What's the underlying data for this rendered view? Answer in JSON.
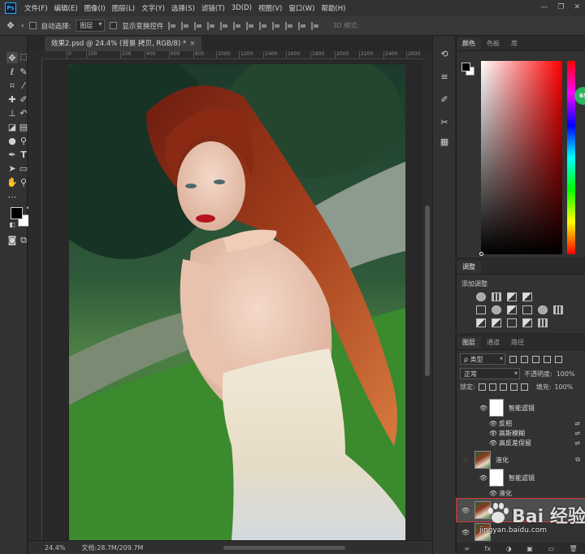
{
  "app": {
    "logo": "Ps"
  },
  "menu": [
    "文件(F)",
    "编辑(E)",
    "图像(I)",
    "图层(L)",
    "文字(Y)",
    "选择(S)",
    "滤镜(T)",
    "3D(D)",
    "视图(V)",
    "窗口(W)",
    "帮助(H)"
  ],
  "window_controls": {
    "minimize": "—",
    "restore": "❐",
    "close": "✕"
  },
  "options": {
    "auto_select_label": "自动选择:",
    "auto_select_value": "图层",
    "show_transform_label": "显示变换控件",
    "mode_3d_label": "3D 模式:"
  },
  "document": {
    "tab_title": "效果2.psd @ 24.4% (背景 拷贝, RGB/8) *",
    "close_glyph": "×",
    "zoom": "24.4%",
    "doc_size": "文档:28.7M/209.7M"
  },
  "ruler": {
    "ticks": [
      "0",
      "100",
      "200",
      "400",
      "600",
      "800",
      "1000",
      "1200",
      "1400",
      "1600",
      "1800",
      "2000",
      "2200",
      "2400",
      "2600"
    ]
  },
  "color_panel": {
    "tabs": [
      "颜色",
      "色板",
      "库"
    ],
    "active": 0,
    "badge": "65"
  },
  "adjustments": {
    "tab": "调整",
    "title": "添加调整"
  },
  "layers_panel": {
    "tabs": [
      "图层",
      "通道",
      "路径"
    ],
    "active": 0,
    "filter_label": "ρ 类型",
    "blend_mode": "正常",
    "opacity_label": "不透明度:",
    "opacity_value": "100%",
    "lock_label": "锁定:",
    "fill_label": "填充:",
    "fill_value": "100%",
    "layers": [
      {
        "name": "智能滤镜",
        "kind": "filter-mask",
        "eye": true
      },
      {
        "name": "反相",
        "kind": "filter",
        "eye": true
      },
      {
        "name": "高斯模糊",
        "kind": "filter",
        "eye": true
      },
      {
        "name": "高反差保留",
        "kind": "filter",
        "eye": true
      },
      {
        "name": "液化",
        "kind": "smart",
        "eye": false
      },
      {
        "name": "智能滤镜",
        "kind": "filter-mask",
        "eye": true
      },
      {
        "name": "液化",
        "kind": "filter",
        "eye": true
      }
    ],
    "bottom_icons": [
      "∞",
      "fx",
      "◑",
      "▣",
      "▭",
      "🗑"
    ]
  },
  "watermark": {
    "main": "Bai 经验",
    "sub": "jingyan.baidu.com"
  },
  "colors": {
    "accent": "#31a8ff",
    "selection_outline": "#d23a3a",
    "badge": "#2fb35c"
  }
}
